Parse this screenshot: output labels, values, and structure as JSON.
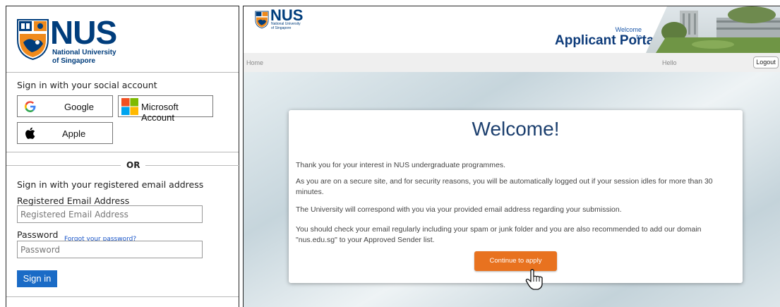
{
  "login": {
    "logo": {
      "wordmark": "NUS",
      "subtitle_line1": "National University",
      "subtitle_line2": "of Singapore"
    },
    "social_title": "Sign in with your social account",
    "social_buttons": [
      {
        "label": "Google",
        "icon": "google-icon"
      },
      {
        "label": "Microsoft Account",
        "icon": "microsoft-icon"
      },
      {
        "label": "Apple",
        "icon": "apple-icon"
      }
    ],
    "or_text": "OR",
    "email_title": "Sign in with your registered email address",
    "email_label": "Registered Email Address",
    "email_placeholder": "Registered Email Address",
    "password_label": "Password",
    "forgot_link": "Forgot your password?",
    "password_placeholder": "Password",
    "signin_label": "Sign in"
  },
  "portal": {
    "logo": {
      "wordmark": "NUS",
      "subtitle_line1": "National University",
      "subtitle_line2": "of Singapore"
    },
    "welcome_to": "Welcome to",
    "portal_title": "Applicant Portal",
    "nav": {
      "home": "Home",
      "hello": "Hello",
      "logout": "Logout"
    },
    "card": {
      "heading": "Welcome!",
      "paragraphs": [
        "Thank you for your interest in NUS undergraduate programmes.",
        "As you are on a secure site, and for security reasons, you will be automatically logged out if your session idles for more than 30 minutes.",
        "The University will correspond with you via your provided email address regarding your submission.",
        "You should check your email regularly including your spam or junk folder and you are also recommended to add our domain \"nus.edu.sg\" to your Approved Sender list."
      ],
      "button": "Continue to apply"
    },
    "colors": {
      "brand_blue": "#003d7c",
      "button_orange": "#e8721f",
      "signin_blue": "#1a6bc6"
    }
  }
}
